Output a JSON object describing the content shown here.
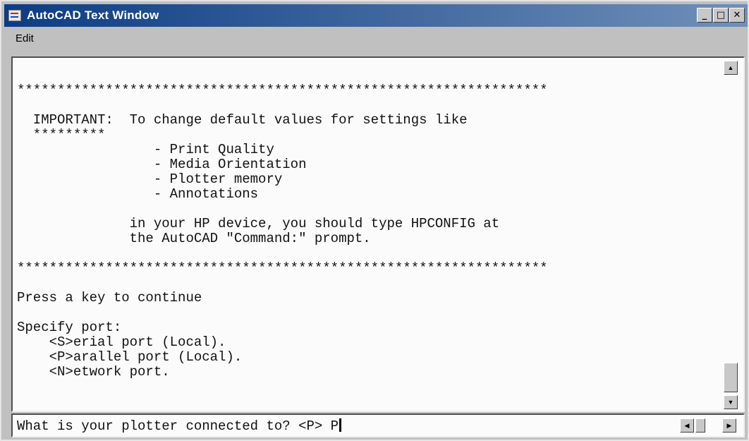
{
  "window": {
    "title": "AutoCAD Text Window",
    "buttons": {
      "minimize": "_",
      "maximize": "□",
      "close": "✕"
    }
  },
  "menu": [
    "Edit"
  ],
  "text_lines": [
    "******************************************************************",
    "",
    "  IMPORTANT:  To change default values for settings like",
    "  *********",
    "                 - Print Quality",
    "                 - Media Orientation",
    "                 - Plotter memory",
    "                 - Annotations",
    "",
    "              in your HP device, you should type HPCONFIG at",
    "              the AutoCAD \"Command:\" prompt.",
    "",
    "******************************************************************",
    "",
    "Press a key to continue",
    "",
    "Specify port:",
    "    <S>erial port (Local).",
    "    <P>arallel port (Local).",
    "    <N>etwork port."
  ],
  "command_line": {
    "prompt": "What is your plotter connected to? <P> P"
  },
  "scrollbar": {
    "up_icon": "scroll-up-arrow",
    "down_icon": "scroll-down-arrow",
    "left_icon": "scroll-left-arrow",
    "right_icon": "scroll-right-arrow"
  }
}
